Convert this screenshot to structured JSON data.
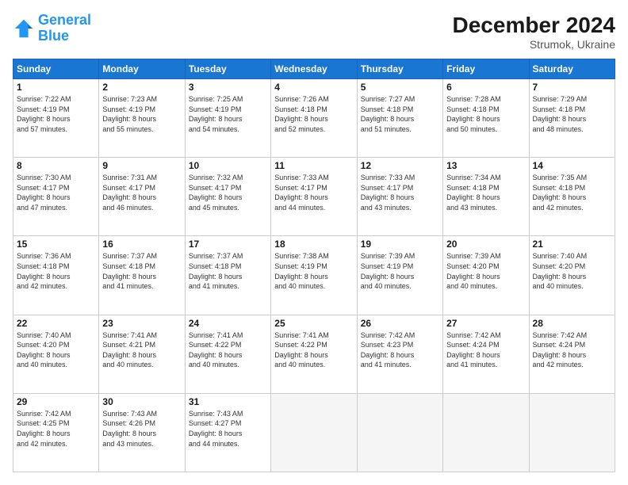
{
  "header": {
    "logo_line1": "General",
    "logo_line2": "Blue",
    "month": "December 2024",
    "location": "Strumok, Ukraine"
  },
  "weekdays": [
    "Sunday",
    "Monday",
    "Tuesday",
    "Wednesday",
    "Thursday",
    "Friday",
    "Saturday"
  ],
  "weeks": [
    [
      {
        "day": "1",
        "info": "Sunrise: 7:22 AM\nSunset: 4:19 PM\nDaylight: 8 hours\nand 57 minutes."
      },
      {
        "day": "2",
        "info": "Sunrise: 7:23 AM\nSunset: 4:19 PM\nDaylight: 8 hours\nand 55 minutes."
      },
      {
        "day": "3",
        "info": "Sunrise: 7:25 AM\nSunset: 4:19 PM\nDaylight: 8 hours\nand 54 minutes."
      },
      {
        "day": "4",
        "info": "Sunrise: 7:26 AM\nSunset: 4:18 PM\nDaylight: 8 hours\nand 52 minutes."
      },
      {
        "day": "5",
        "info": "Sunrise: 7:27 AM\nSunset: 4:18 PM\nDaylight: 8 hours\nand 51 minutes."
      },
      {
        "day": "6",
        "info": "Sunrise: 7:28 AM\nSunset: 4:18 PM\nDaylight: 8 hours\nand 50 minutes."
      },
      {
        "day": "7",
        "info": "Sunrise: 7:29 AM\nSunset: 4:18 PM\nDaylight: 8 hours\nand 48 minutes."
      }
    ],
    [
      {
        "day": "8",
        "info": "Sunrise: 7:30 AM\nSunset: 4:17 PM\nDaylight: 8 hours\nand 47 minutes."
      },
      {
        "day": "9",
        "info": "Sunrise: 7:31 AM\nSunset: 4:17 PM\nDaylight: 8 hours\nand 46 minutes."
      },
      {
        "day": "10",
        "info": "Sunrise: 7:32 AM\nSunset: 4:17 PM\nDaylight: 8 hours\nand 45 minutes."
      },
      {
        "day": "11",
        "info": "Sunrise: 7:33 AM\nSunset: 4:17 PM\nDaylight: 8 hours\nand 44 minutes."
      },
      {
        "day": "12",
        "info": "Sunrise: 7:33 AM\nSunset: 4:17 PM\nDaylight: 8 hours\nand 43 minutes."
      },
      {
        "day": "13",
        "info": "Sunrise: 7:34 AM\nSunset: 4:18 PM\nDaylight: 8 hours\nand 43 minutes."
      },
      {
        "day": "14",
        "info": "Sunrise: 7:35 AM\nSunset: 4:18 PM\nDaylight: 8 hours\nand 42 minutes."
      }
    ],
    [
      {
        "day": "15",
        "info": "Sunrise: 7:36 AM\nSunset: 4:18 PM\nDaylight: 8 hours\nand 42 minutes."
      },
      {
        "day": "16",
        "info": "Sunrise: 7:37 AM\nSunset: 4:18 PM\nDaylight: 8 hours\nand 41 minutes."
      },
      {
        "day": "17",
        "info": "Sunrise: 7:37 AM\nSunset: 4:18 PM\nDaylight: 8 hours\nand 41 minutes."
      },
      {
        "day": "18",
        "info": "Sunrise: 7:38 AM\nSunset: 4:19 PM\nDaylight: 8 hours\nand 40 minutes."
      },
      {
        "day": "19",
        "info": "Sunrise: 7:39 AM\nSunset: 4:19 PM\nDaylight: 8 hours\nand 40 minutes."
      },
      {
        "day": "20",
        "info": "Sunrise: 7:39 AM\nSunset: 4:20 PM\nDaylight: 8 hours\nand 40 minutes."
      },
      {
        "day": "21",
        "info": "Sunrise: 7:40 AM\nSunset: 4:20 PM\nDaylight: 8 hours\nand 40 minutes."
      }
    ],
    [
      {
        "day": "22",
        "info": "Sunrise: 7:40 AM\nSunset: 4:20 PM\nDaylight: 8 hours\nand 40 minutes."
      },
      {
        "day": "23",
        "info": "Sunrise: 7:41 AM\nSunset: 4:21 PM\nDaylight: 8 hours\nand 40 minutes."
      },
      {
        "day": "24",
        "info": "Sunrise: 7:41 AM\nSunset: 4:22 PM\nDaylight: 8 hours\nand 40 minutes."
      },
      {
        "day": "25",
        "info": "Sunrise: 7:41 AM\nSunset: 4:22 PM\nDaylight: 8 hours\nand 40 minutes."
      },
      {
        "day": "26",
        "info": "Sunrise: 7:42 AM\nSunset: 4:23 PM\nDaylight: 8 hours\nand 41 minutes."
      },
      {
        "day": "27",
        "info": "Sunrise: 7:42 AM\nSunset: 4:24 PM\nDaylight: 8 hours\nand 41 minutes."
      },
      {
        "day": "28",
        "info": "Sunrise: 7:42 AM\nSunset: 4:24 PM\nDaylight: 8 hours\nand 42 minutes."
      }
    ],
    [
      {
        "day": "29",
        "info": "Sunrise: 7:42 AM\nSunset: 4:25 PM\nDaylight: 8 hours\nand 42 minutes."
      },
      {
        "day": "30",
        "info": "Sunrise: 7:43 AM\nSunset: 4:26 PM\nDaylight: 8 hours\nand 43 minutes."
      },
      {
        "day": "31",
        "info": "Sunrise: 7:43 AM\nSunset: 4:27 PM\nDaylight: 8 hours\nand 44 minutes."
      },
      null,
      null,
      null,
      null
    ]
  ]
}
